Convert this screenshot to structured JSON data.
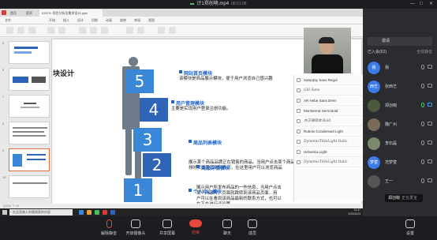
{
  "meeting": {
    "title": "计1郑创萌.mp4",
    "timer": "00:21:06"
  },
  "wps": {
    "tabs": [
      "首页",
      "稻壳",
      "03374~项目分析及需求设计.pptx"
    ],
    "menu": [
      "文件",
      "开始",
      "插入",
      "设计",
      "切换",
      "动画",
      "放映",
      "审阅",
      "视图"
    ],
    "status": "幻灯片 7 / 12"
  },
  "thumbs": [
    {
      "num": "5"
    },
    {
      "num": "6"
    },
    {
      "num": "7"
    },
    {
      "num": "8"
    },
    {
      "num": "9"
    },
    {
      "num": "10"
    }
  ],
  "slide": {
    "title_fragment": "块设计",
    "cubes": [
      "5",
      "4",
      "3",
      "2",
      "1"
    ],
    "modules": [
      {
        "head": "网站首页模块",
        "desc": "该模块是商品展示模块，便于用户浏览自己感兴趣"
      },
      {
        "head": "用户管理模块",
        "desc": "主要是实现用户登录注册功能。"
      },
      {
        "head": "商品列表模块",
        "desc": "展示某个商品品牌正在销售的商品。当用户点击某个商品时，\n排时页面跳转到列表页，在这里用户可以浏览商品"
      },
      {
        "head": "商品详情模块",
        "desc": "展示用户所发布商品的一些信息，当用户点击\n某个商品时，页面就跳转到该商品页面，用\n户可以在看到该商品最新的联系方式，也可以\n在下方进行评论等。"
      },
      {
        "head": "个人中心模块",
        "desc": ""
      }
    ]
  },
  "fonts": [
    {
      "name": "Saturday Sans Regul",
      "style": "normal"
    },
    {
      "name": "Gill Sans",
      "style": "script"
    },
    {
      "name": "AR Hebe Sans Demi",
      "style": "normal"
    },
    {
      "name": "Montserrat Semi Bold",
      "style": "normal"
    },
    {
      "name": "方正喵呜体 Bold",
      "style": "script"
    },
    {
      "name": "Roboto Condensed Light",
      "style": "normal"
    },
    {
      "name": "DynamicTitleLight Italic",
      "style": "script"
    },
    {
      "name": "Helvetica Light",
      "style": "normal"
    },
    {
      "name": "DynamicTitleLight Italic",
      "style": "script"
    }
  ],
  "taskbar": {
    "search_placeholder": "在这里输入你要搜索的内容",
    "clock": "13:47\n2020/6/23"
  },
  "panel": {
    "invite_label": "邀请",
    "count_label": "已入会(52)",
    "count_right": "全体静音",
    "participants": [
      {
        "name": "我",
        "avatar": "我",
        "color": "#3c7be8"
      },
      {
        "name": "张西艺",
        "avatar": "西艺",
        "color": "#3c7be8"
      },
      {
        "name": "郑创萌",
        "avatar": "",
        "color": "#4a5a3a"
      },
      {
        "name": "魏广州",
        "avatar": "",
        "color": "#7a6a5a"
      },
      {
        "name": "李石磊",
        "avatar": "",
        "color": "#7a8a6a"
      },
      {
        "name": "范梦萱",
        "avatar": "梦萱",
        "color": "#3c7be8"
      },
      {
        "name": "王一",
        "avatar": "",
        "color": "#555"
      }
    ],
    "speaker_name": "郑创萌",
    "speaker_status": "正在发言"
  },
  "controls": [
    {
      "label": "解除静音",
      "icon": "mic-off-icon"
    },
    {
      "label": "开启摄像头",
      "icon": "camera-icon"
    },
    {
      "label": "共享屏幕",
      "icon": "share-screen-icon"
    },
    {
      "label": "结束",
      "icon": "end-call-icon"
    },
    {
      "label": "聊天",
      "icon": "chat-icon"
    },
    {
      "label": "成员",
      "icon": "members-icon"
    },
    {
      "label": "设置",
      "icon": "settings-icon"
    }
  ],
  "colors": {
    "accent": "#1f64c9",
    "end_red": "#e4473e",
    "cube": "#2f64b8"
  }
}
